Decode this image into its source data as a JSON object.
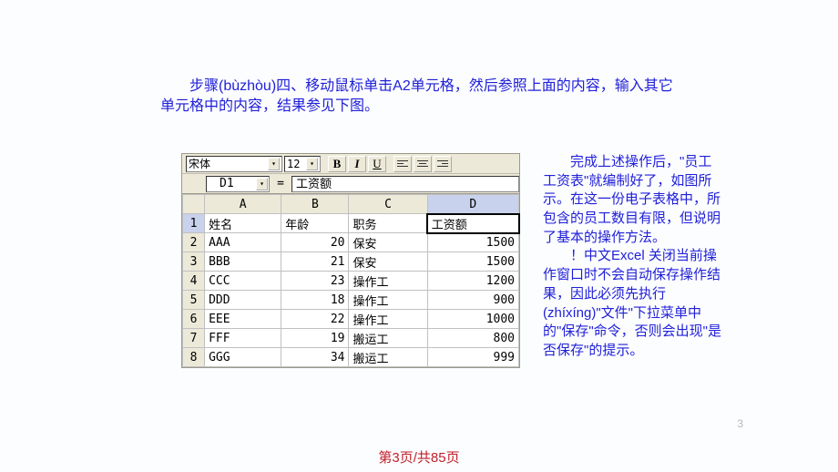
{
  "intro": "步骤(bùzhòu)四、移动鼠标单击A2单元格，然后参照上面的内容，输入其它单元格中的内容，结果参见下图。",
  "excel": {
    "font_name": "宋体",
    "font_size": "12",
    "bold": "B",
    "italic": "I",
    "underline": "U",
    "active_ref": "D1",
    "eq": "=",
    "formula_value": "工资额",
    "cols": [
      "A",
      "B",
      "C",
      "D"
    ],
    "header": {
      "name": "姓名",
      "age": "年龄",
      "job": "职务",
      "salary": "工资额"
    },
    "rows": [
      {
        "n": "1",
        "name": "姓名",
        "age": "年龄",
        "job": "职务",
        "salary": "工资额",
        "isHeader": true
      },
      {
        "n": "2",
        "name": "AAA",
        "age": "20",
        "job": "保安",
        "salary": "1500"
      },
      {
        "n": "3",
        "name": "BBB",
        "age": "21",
        "job": "保安",
        "salary": "1500"
      },
      {
        "n": "4",
        "name": "CCC",
        "age": "23",
        "job": "操作工",
        "salary": "1200"
      },
      {
        "n": "5",
        "name": "DDD",
        "age": "18",
        "job": "操作工",
        "salary": "900"
      },
      {
        "n": "6",
        "name": "EEE",
        "age": "22",
        "job": "操作工",
        "salary": "1000"
      },
      {
        "n": "7",
        "name": "FFF",
        "age": "19",
        "job": "搬运工",
        "salary": "800"
      },
      {
        "n": "8",
        "name": "GGG",
        "age": "34",
        "job": "搬运工",
        "salary": "999"
      }
    ]
  },
  "right_p1": "完成上述操作后，\"员工工资表\"就编制好了，如图所示。在这一份电子表格中，所包含的员工数目有限，但说明了基本的操作方法。",
  "right_p2": "！中文Excel 关闭当前操作窗口时不会自动保存操作结果，因此必须先执行(zhíxíng)\"文件\"下拉菜单中的\"保存\"命令，否则会出现\"是否保存\"的提示。",
  "page_small": "3",
  "footer": "第3页/共85页"
}
